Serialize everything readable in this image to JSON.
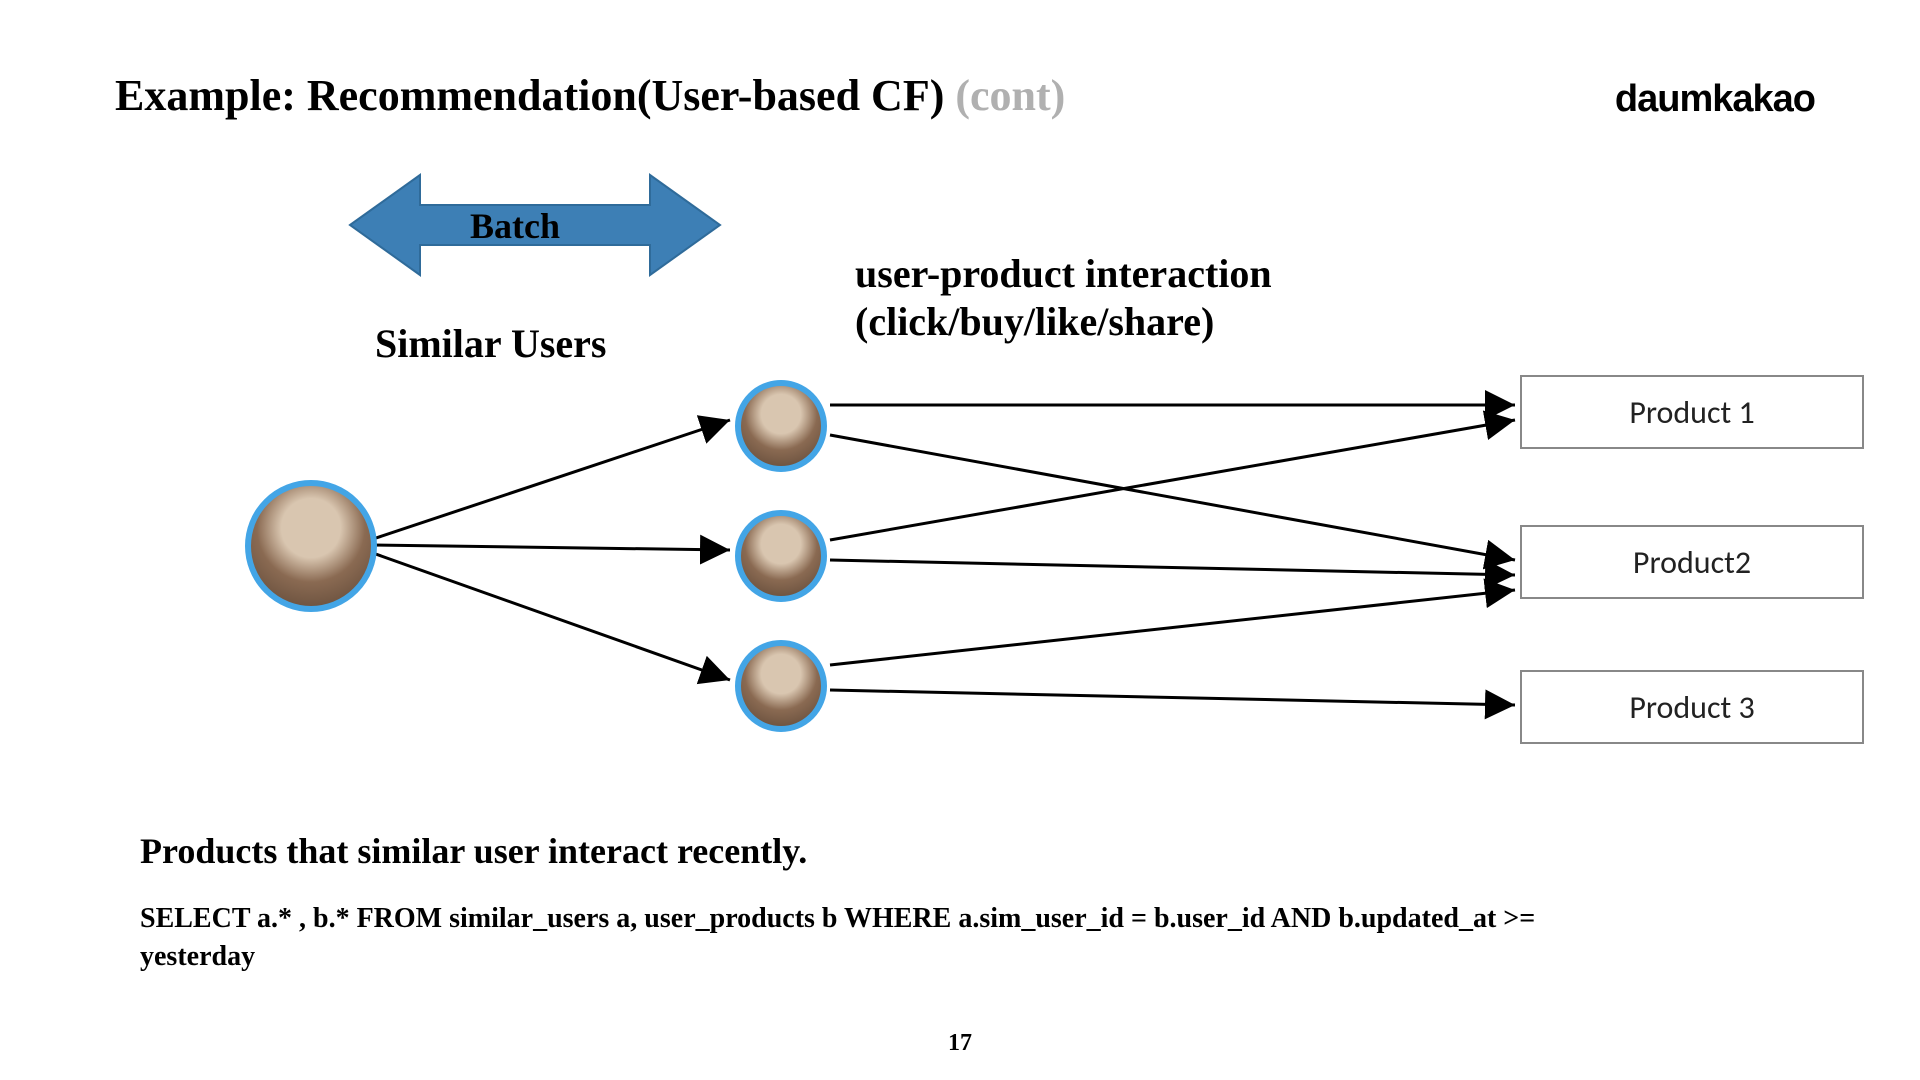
{
  "title_main": "Example: Recommendation(User-based CF) ",
  "title_suffix": "(cont)",
  "brand": "daumkakao",
  "batch_label": "Batch",
  "similar_label": "Similar Users",
  "interaction_line1": "user-product interaction",
  "interaction_line2": "(click/buy/like/share)",
  "products": {
    "p1": "Product 1",
    "p2": "Product2",
    "p3": "Product 3"
  },
  "caption": "Products that similar user interact recently.",
  "sql": "SELECT a.* , b.* FROM  similar_users a, user_products b WHERE a.sim_user_id = b.user_id AND  b.updated_at >= yesterday",
  "page_number": "17"
}
